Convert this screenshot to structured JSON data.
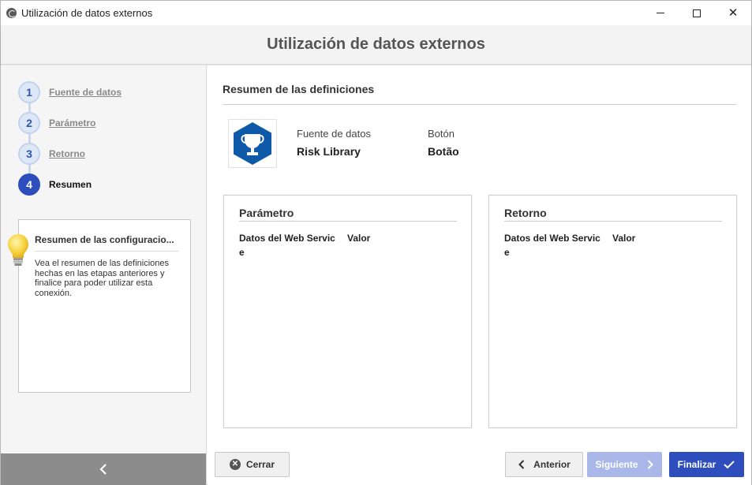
{
  "window": {
    "title": "Utilización de datos externos"
  },
  "header": {
    "title": "Utilización de datos externos"
  },
  "steps": [
    {
      "number": "1",
      "label": "Fuente de datos",
      "state": "done"
    },
    {
      "number": "2",
      "label": "Parámetro",
      "state": "done"
    },
    {
      "number": "3",
      "label": "Retorno",
      "state": "done"
    },
    {
      "number": "4",
      "label": "Resumen",
      "state": "active"
    }
  ],
  "tip": {
    "title": "Resumen de las configuracio...",
    "body": "Vea el resumen de las definiciones hechas en las etapas anteriores y finalice para poder utilizar esta conexión."
  },
  "summary": {
    "title": "Resumen de las definiciones",
    "source_label": "Fuente de datos",
    "source_value": "Risk Library",
    "button_label": "Botón",
    "button_value": "Botão"
  },
  "parametro_panel": {
    "title": "Parámetro",
    "col1_line1": "Datos del Web Servic",
    "col1_line2": "e",
    "col2": "Valor"
  },
  "retorno_panel": {
    "title": "Retorno",
    "col1_line1": "Datos del Web Servic",
    "col1_line2": "e",
    "col2": "Valor"
  },
  "buttons": {
    "cerrar": "Cerrar",
    "anterior": "Anterior",
    "siguiente": "Siguiente",
    "finalizar": "Finalizar"
  },
  "colors": {
    "accent": "#2f4ebd",
    "accent_disabled": "#a9b8e8",
    "logo_blue": "#0f5aa8"
  },
  "icons": {
    "app": "globe-icon",
    "logo": "trophy-icon",
    "tip": "lightbulb-icon",
    "collapse": "chevron-left-icon"
  }
}
